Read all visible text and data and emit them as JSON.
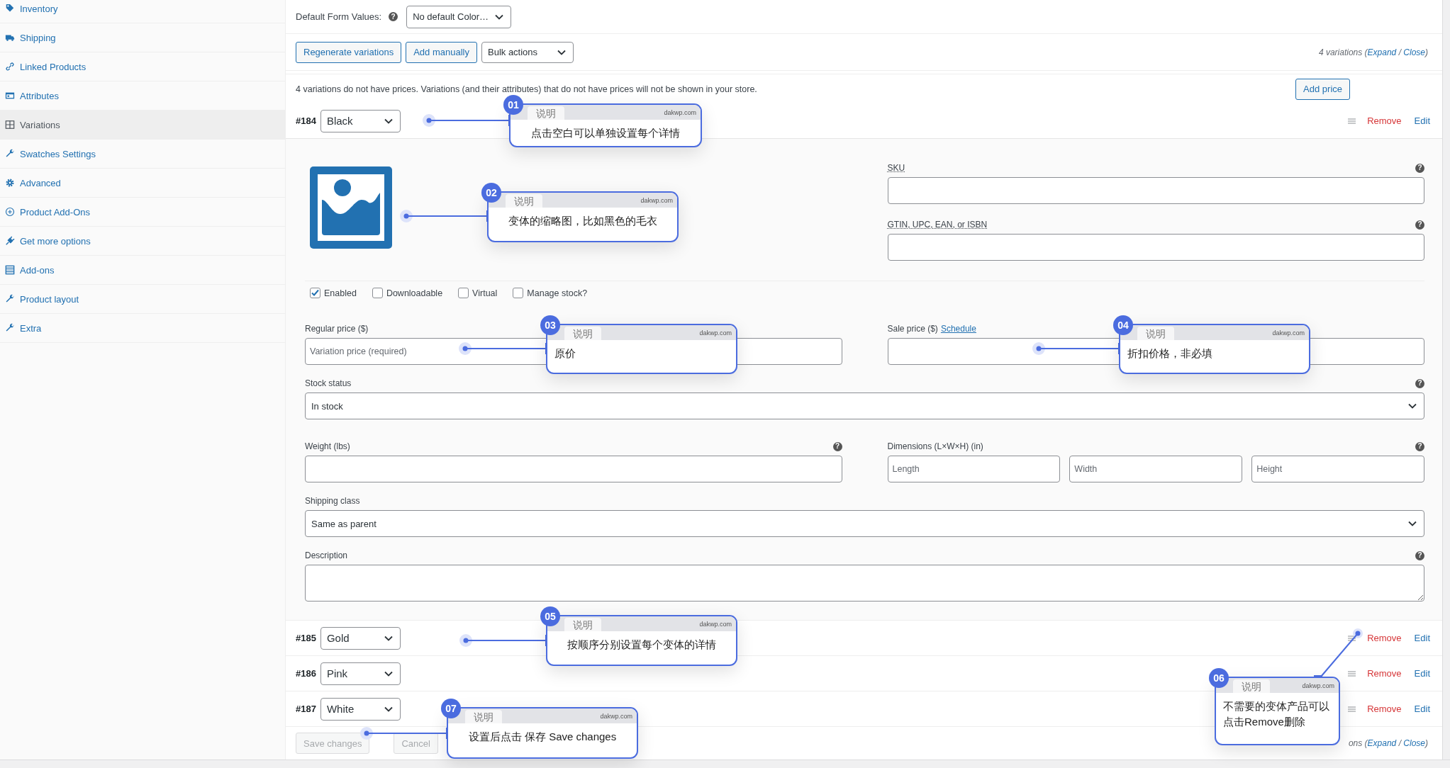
{
  "sidebar": {
    "items": [
      {
        "label": "Inventory",
        "selected": false
      },
      {
        "label": "Shipping",
        "selected": false
      },
      {
        "label": "Linked Products",
        "selected": false
      },
      {
        "label": "Attributes",
        "selected": false
      },
      {
        "label": "Variations",
        "selected": true
      },
      {
        "label": "Swatches Settings",
        "selected": false
      },
      {
        "label": "Advanced",
        "selected": false
      },
      {
        "label": "Product Add-Ons",
        "selected": false
      },
      {
        "label": "Get more options",
        "selected": false
      },
      {
        "label": "Add-ons",
        "selected": false
      },
      {
        "label": "Product layout",
        "selected": false
      },
      {
        "label": "Extra",
        "selected": false
      }
    ]
  },
  "default_form": {
    "label": "Default Form Values:",
    "help": "?",
    "value": "No default Color…"
  },
  "toolbar": {
    "buttons": [
      "Regenerate variations",
      "Add manually"
    ],
    "bulk_actions": "Bulk actions",
    "count_prefix": "4 variations (",
    "links": [
      "Expand",
      "Close"
    ],
    "separator": " / ",
    "count_suffix": ")"
  },
  "notice": {
    "text": "4 variations do not have prices. Variations (and their attributes) that do not have prices will not be shown in your store.",
    "button": "Add price"
  },
  "variations": [
    {
      "id": "#184",
      "value": "Black",
      "expanded": true,
      "actions": [
        "Remove",
        "Edit"
      ],
      "details": {
        "sku": {
          "label": "SKU",
          "help": "?"
        },
        "gtin": {
          "label": "GTIN, UPC, EAN, or ISBN",
          "help": "?"
        },
        "checkboxes": [
          {
            "label": "Enabled",
            "checked": true
          },
          {
            "label": "Downloadable",
            "checked": false
          },
          {
            "label": "Virtual",
            "checked": false
          },
          {
            "label": "Manage stock?",
            "checked": false
          }
        ],
        "regular_price": {
          "label": "Regular price ($)",
          "placeholder": "Variation price (required)"
        },
        "sale_price": {
          "label": "Sale price ($)",
          "link": "Schedule"
        },
        "stock_status": {
          "label": "Stock status",
          "help": "?",
          "value": "In stock"
        },
        "weight": {
          "label": "Weight (lbs)",
          "help": "?"
        },
        "dimensions": {
          "label": "Dimensions (L×W×H) (in)",
          "help": "?",
          "placeholders": [
            "Length",
            "Width",
            "Height"
          ]
        },
        "shipping_class": {
          "label": "Shipping class",
          "value": "Same as parent"
        },
        "description": {
          "label": "Description",
          "help": "?"
        }
      }
    },
    {
      "id": "#185",
      "value": "Gold",
      "expanded": false,
      "actions": [
        "Remove",
        "Edit"
      ]
    },
    {
      "id": "#186",
      "value": "Pink",
      "expanded": false,
      "actions": [
        "Remove",
        "Edit"
      ]
    },
    {
      "id": "#187",
      "value": "White",
      "expanded": false,
      "actions": [
        "Remove",
        "Edit"
      ]
    }
  ],
  "footer": {
    "buttons": [
      {
        "label": "Save changes",
        "disabled": true
      },
      {
        "label": "Cancel",
        "disabled": true
      }
    ],
    "count_prefix": "ons (",
    "links": [
      "Expand",
      "Close"
    ],
    "separator": " / ",
    "count_suffix": ")"
  },
  "callouts": [
    {
      "number": "01",
      "tab": "说明",
      "site": "dakwp.com",
      "text": "点击空白可以单独设置每个详情"
    },
    {
      "number": "02",
      "tab": "说明",
      "site": "dakwp.com",
      "text": "变体的缩略图，比如黑色的毛衣"
    },
    {
      "number": "03",
      "tab": "说明",
      "site": "dakwp.com",
      "text": "原价"
    },
    {
      "number": "04",
      "tab": "说明",
      "site": "dakwp.com",
      "text": "折扣价格，非必填"
    },
    {
      "number": "05",
      "tab": "说明",
      "site": "dakwp.com",
      "text": "按顺序分别设置每个变体的详情"
    },
    {
      "number": "06",
      "tab": "说明",
      "site": "dakwp.com",
      "text": "不需要的变体产品可以点击Remove删除"
    },
    {
      "number": "07",
      "tab": "说明",
      "site": "dakwp.com",
      "text": "设置后点击 保存 Save changes"
    }
  ]
}
